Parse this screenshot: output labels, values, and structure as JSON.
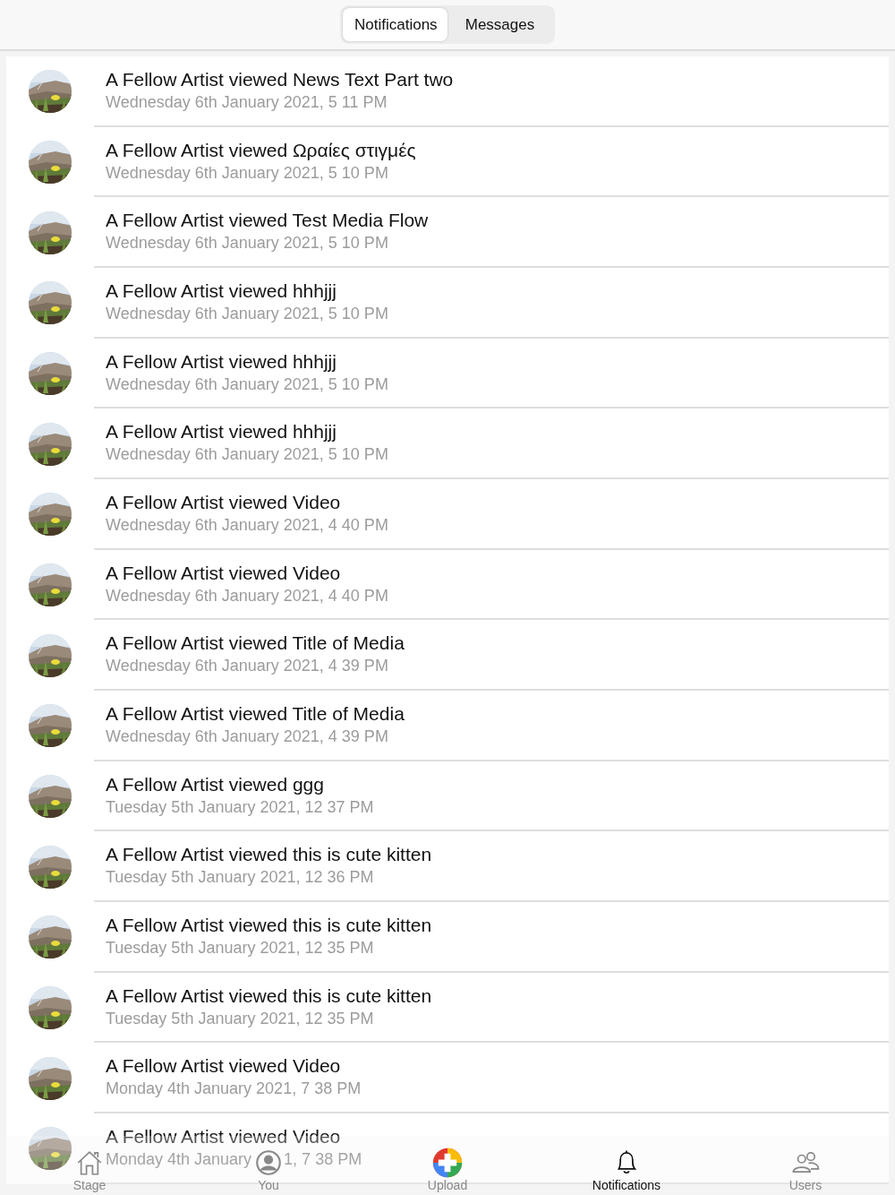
{
  "segments": [
    {
      "label": "Notifications",
      "selected": true
    },
    {
      "label": "Messages",
      "selected": false
    }
  ],
  "notifications": [
    {
      "title": "A Fellow Artist viewed News Text Part two",
      "time": "Wednesday 6th January 2021, 5 11 PM"
    },
    {
      "title": "A Fellow Artist viewed Ωραίες στιγμές",
      "time": "Wednesday 6th January 2021, 5 10 PM"
    },
    {
      "title": "A Fellow Artist viewed Test Media Flow",
      "time": "Wednesday 6th January 2021, 5 10 PM"
    },
    {
      "title": "A Fellow Artist viewed hhhjjj",
      "time": "Wednesday 6th January 2021, 5 10 PM"
    },
    {
      "title": "A Fellow Artist viewed hhhjjj",
      "time": "Wednesday 6th January 2021, 5 10 PM"
    },
    {
      "title": "A Fellow Artist viewed hhhjjj",
      "time": "Wednesday 6th January 2021, 5 10 PM"
    },
    {
      "title": "A Fellow Artist viewed Video",
      "time": "Wednesday 6th January 2021, 4 40 PM"
    },
    {
      "title": "A Fellow Artist viewed Video",
      "time": "Wednesday 6th January 2021, 4 40 PM"
    },
    {
      "title": "A Fellow Artist viewed Title of Media",
      "time": "Wednesday 6th January 2021, 4 39 PM"
    },
    {
      "title": "A Fellow Artist viewed Title of Media",
      "time": "Wednesday 6th January 2021, 4 39 PM"
    },
    {
      "title": "A Fellow Artist viewed ggg",
      "time": "Tuesday 5th January 2021, 12 37 PM"
    },
    {
      "title": "A Fellow Artist viewed this is cute kitten",
      "time": "Tuesday 5th January 2021, 12 36 PM"
    },
    {
      "title": "A Fellow Artist viewed this is cute kitten",
      "time": "Tuesday 5th January 2021, 12 35 PM"
    },
    {
      "title": "A Fellow Artist viewed this is cute kitten",
      "time": "Tuesday 5th January 2021, 12 35 PM"
    },
    {
      "title": "A Fellow Artist viewed Video",
      "time": "Monday 4th January 2021, 7 38 PM"
    },
    {
      "title": "A Fellow Artist viewed Video",
      "time_parts": [
        "Monday 4th January",
        "1, 7 38 PM"
      ]
    }
  ],
  "tab_bar": [
    {
      "kind": "home",
      "label": "Stage",
      "selected": false
    },
    {
      "kind": "person",
      "label": "You",
      "selected": false
    },
    {
      "kind": "upload",
      "label": "Upload",
      "selected": false
    },
    {
      "kind": "bell",
      "label": "Notifications",
      "selected": true
    },
    {
      "kind": "users",
      "label": "Users",
      "selected": false
    }
  ]
}
